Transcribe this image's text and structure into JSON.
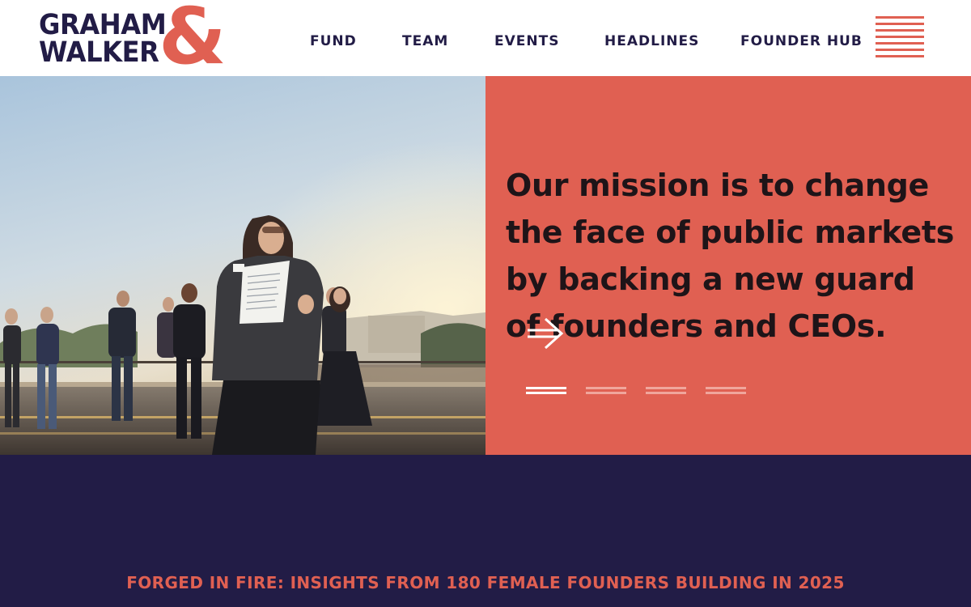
{
  "brand": {
    "name_line1": "GRAHAM",
    "name_line2": "WALKER",
    "ampersand": "&",
    "colors": {
      "coral": "#e06052",
      "navy": "#221c46",
      "white": "#ffffff"
    }
  },
  "nav": {
    "items": [
      {
        "label": "FUND"
      },
      {
        "label": "TEAM"
      },
      {
        "label": "EVENTS"
      },
      {
        "label": "HEADLINES"
      },
      {
        "label": "FOUNDER HUB"
      }
    ],
    "menu_icon": "hamburger-menu-icon"
  },
  "hero": {
    "mission": "Our mission is to change the face of public markets by backing a new guard of founders and CEOs.",
    "next_icon": "double-arrow-right-icon",
    "slides_total": 4,
    "slide_active": 1
  },
  "feature": {
    "headline": "FORGED IN FIRE: INSIGHTS FROM 180 FEMALE FOUNDERS BUILDING IN 2025"
  }
}
